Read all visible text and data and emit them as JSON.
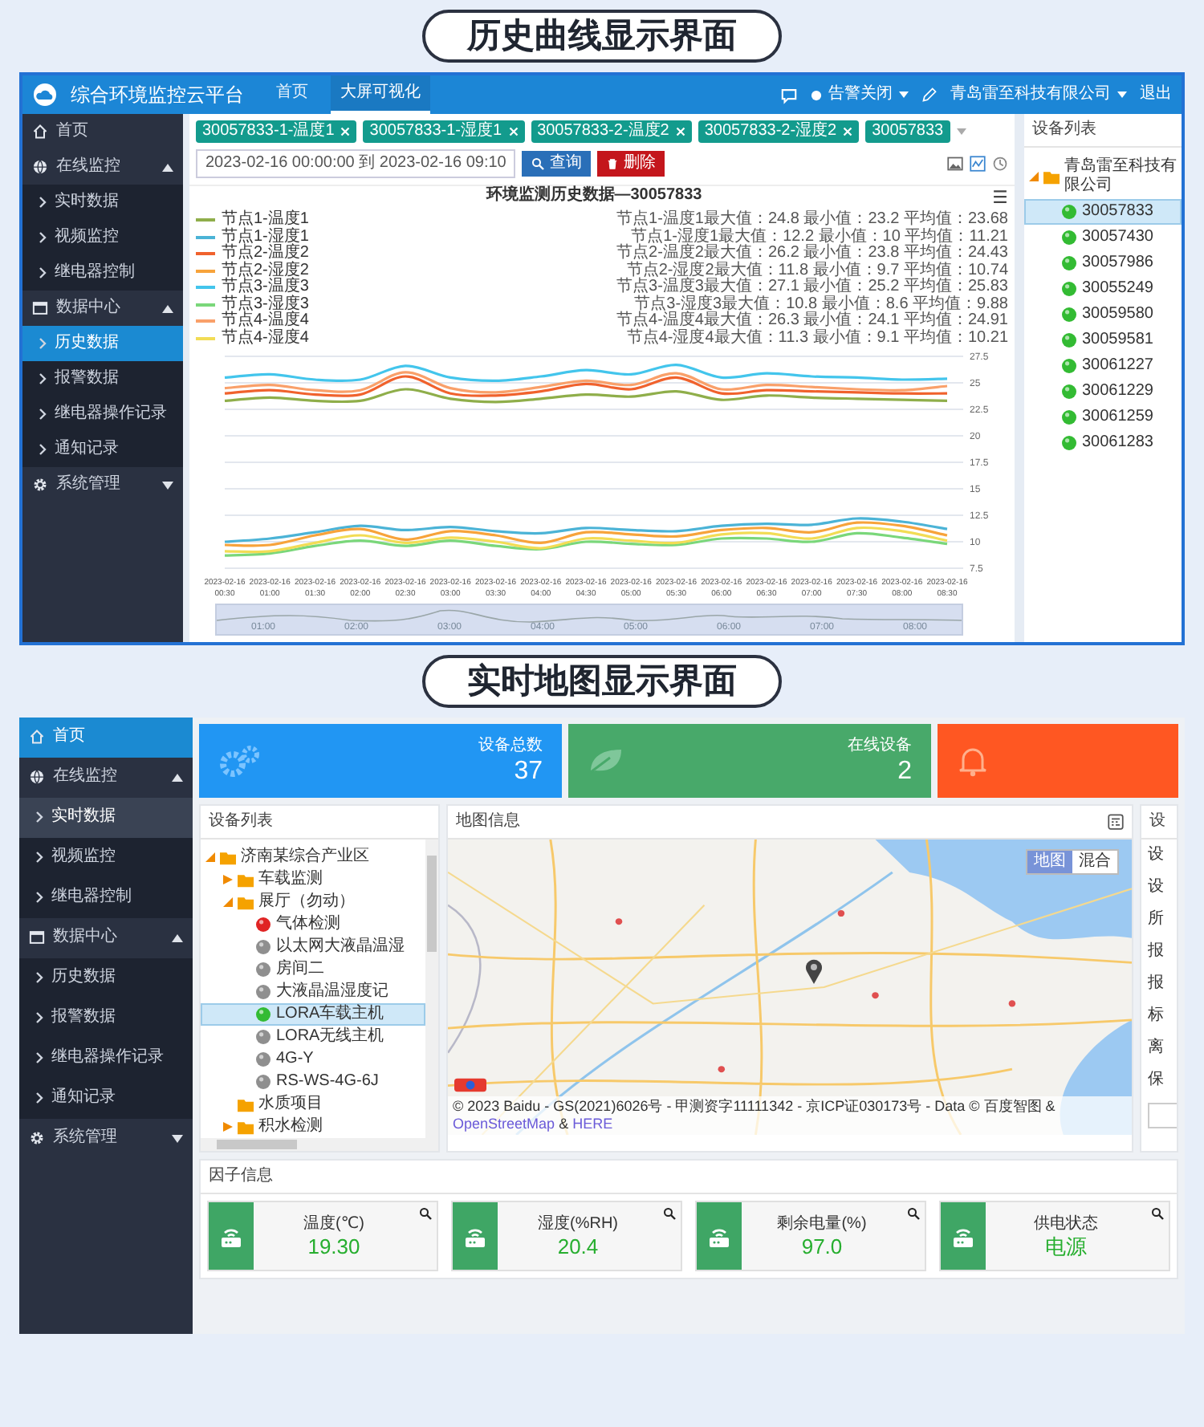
{
  "history_heading": "历史曲线显示界面",
  "history_screen": {
    "app_title": "综合环境监控云平台",
    "nav_tabs": [
      {
        "label": "首页",
        "selected": false
      },
      {
        "label": "大屏可视化",
        "selected": true
      }
    ],
    "alarm_menu": "告警关闭",
    "user_menu": "青岛雷至科技有限公司",
    "logout": "退出",
    "sidebar": [
      {
        "label": "首页",
        "selected": false
      },
      {
        "label": "在线监控",
        "selected": false,
        "expanded": true,
        "children": [
          {
            "label": "实时数据",
            "selected": false
          },
          {
            "label": "视频监控",
            "selected": false
          },
          {
            "label": "继电器控制",
            "selected": false
          }
        ]
      },
      {
        "label": "数据中心",
        "selected": false,
        "expanded": true,
        "children": [
          {
            "label": "历史数据",
            "selected": true
          },
          {
            "label": "报警数据",
            "selected": false
          },
          {
            "label": "继电器操作记录",
            "selected": false
          },
          {
            "label": "通知记录",
            "selected": false
          }
        ]
      },
      {
        "label": "系统管理",
        "selected": false,
        "expanded": false
      }
    ],
    "tags": [
      {
        "label": "30057833-1-温度1",
        "removable": true
      },
      {
        "label": "30057833-1-湿度1",
        "removable": true
      },
      {
        "label": "30057833-2-温度2",
        "removable": true
      },
      {
        "label": "30057833-2-湿度2",
        "removable": true
      },
      {
        "label": "30057833",
        "removable": false
      }
    ],
    "date_range": "2023-02-16 00:00:00 到 2023-02-16 09:10",
    "buttons": [
      {
        "label": "查询",
        "kind": "search"
      },
      {
        "label": "删除",
        "kind": "delete"
      }
    ],
    "chart": {
      "summary_lines": [
        "节点1-温度1最大值：24.8 最小值：23.2 平均值：23.68",
        "节点1-湿度1最大值：12.2 最小值：10 平均值：11.21",
        "节点2-温度2最大值：26.2 最小值：23.8 平均值：24.43",
        "节点2-湿度2最大值：11.8 最小值：9.7 平均值：10.74",
        "节点3-温度3最大值：27.1 最小值：25.2 平均值：25.83",
        "节点3-湿度3最大值：10.8 最小值：8.6 平均值：9.88",
        "节点4-温度4最大值：26.3 最小值：24.1 平均值：24.91",
        "节点4-湿度4最大值：11.3 最小值：9.1 平均值：10.21"
      ],
      "zoom_labels": [
        "01:00",
        "02:00",
        "03:00",
        "04:00",
        "05:00",
        "06:00",
        "07:00",
        "08:00"
      ],
      "chart_data": {
        "type": "line",
        "title": "环境监测历史数据—30057833",
        "categories": [
          "2023-02-16 00:30",
          "2023-02-16 01:00",
          "2023-02-16 01:30",
          "2023-02-16 02:00",
          "2023-02-16 02:30",
          "2023-02-16 03:00",
          "2023-02-16 03:30",
          "2023-02-16 04:00",
          "2023-02-16 04:30",
          "2023-02-16 05:00",
          "2023-02-16 05:30",
          "2023-02-16 06:00",
          "2023-02-16 06:30",
          "2023-02-16 07:00",
          "2023-02-16 07:30",
          "2023-02-16 08:00",
          "2023-02-16 08:30"
        ],
        "ylim": [
          7.5,
          27.5
        ],
        "grid": true,
        "legend": true,
        "yticks": [
          7.5,
          10,
          12.5,
          15,
          17.5,
          20,
          22.5,
          25,
          27.5
        ],
        "series": [
          {
            "name": "节点1-温度1",
            "color": "#8fae4a",
            "values": [
              23.3,
              23.6,
              23.3,
              23.3,
              24.4,
              23.5,
              23.2,
              23.5,
              23.9,
              23.7,
              24.2,
              23.4,
              23.8,
              23.6,
              23.5,
              23.4,
              23.3
            ]
          },
          {
            "name": "节点1-湿度1",
            "color": "#4bb3d6",
            "values": [
              10.0,
              10.3,
              10.9,
              11.5,
              11.1,
              11.4,
              11.0,
              10.8,
              11.3,
              11.1,
              11.0,
              11.5,
              11.7,
              11.6,
              12.2,
              11.9,
              11.2
            ]
          },
          {
            "name": "节点2-温度2",
            "color": "#f0622d",
            "values": [
              24.0,
              24.3,
              23.9,
              23.9,
              25.6,
              24.0,
              23.8,
              24.2,
              24.9,
              24.4,
              25.5,
              24.0,
              24.3,
              24.2,
              24.1,
              24.0,
              24.0
            ]
          },
          {
            "name": "节点2-湿度2",
            "color": "#f7a33b",
            "values": [
              9.7,
              9.7,
              10.6,
              11.2,
              10.2,
              11.0,
              10.6,
              9.9,
              10.9,
              10.7,
              10.5,
              11.1,
              11.3,
              10.9,
              11.8,
              11.5,
              10.6
            ]
          },
          {
            "name": "节点3-温度3",
            "color": "#43c5ec",
            "values": [
              25.5,
              25.8,
              25.3,
              25.3,
              26.6,
              25.5,
              25.2,
              25.6,
              26.2,
              25.8,
              26.7,
              25.5,
              25.9,
              25.6,
              25.5,
              25.3,
              25.4
            ]
          },
          {
            "name": "节点3-湿度3",
            "color": "#7ad77a",
            "values": [
              8.7,
              8.9,
              9.6,
              10.1,
              9.6,
              10.1,
              9.6,
              9.3,
              10.0,
              9.8,
              9.7,
              10.3,
              10.3,
              10.0,
              10.8,
              10.4,
              9.8
            ]
          },
          {
            "name": "节点4-温度4",
            "color": "#f9a06a",
            "values": [
              24.5,
              24.8,
              24.3,
              24.3,
              26.0,
              24.5,
              24.1,
              24.6,
              25.2,
              24.8,
              25.9,
              24.4,
              24.8,
              24.6,
              24.4,
              24.3,
              24.7
            ]
          },
          {
            "name": "节点4-湿度4",
            "color": "#f2dc55",
            "values": [
              9.1,
              9.1,
              9.9,
              10.6,
              9.9,
              10.4,
              10.0,
              9.4,
              10.3,
              10.1,
              9.9,
              10.7,
              10.8,
              10.3,
              11.3,
              11.0,
              10.1
            ]
          }
        ]
      }
    },
    "device_panel": {
      "title": "设备列表",
      "root": {
        "label": "青岛雷至科技有限公司",
        "kind": "folder",
        "expanded": true,
        "children": [
          {
            "label": "30057833",
            "kind": "device",
            "color": "#33bb33",
            "selected": true
          },
          {
            "label": "30057430",
            "kind": "device",
            "color": "#33bb33",
            "selected": false
          },
          {
            "label": "30057986",
            "kind": "device",
            "color": "#33bb33",
            "selected": false
          },
          {
            "label": "30055249",
            "kind": "device",
            "color": "#33bb33",
            "selected": false
          },
          {
            "label": "30059580",
            "kind": "device",
            "color": "#33bb33",
            "selected": false
          },
          {
            "label": "30059581",
            "kind": "device",
            "color": "#33bb33",
            "selected": false
          },
          {
            "label": "30061227",
            "kind": "device",
            "color": "#33bb33",
            "selected": false
          },
          {
            "label": "30061229",
            "kind": "device",
            "color": "#33bb33",
            "selected": false
          },
          {
            "label": "30061259",
            "kind": "device",
            "color": "#33bb33",
            "selected": false
          },
          {
            "label": "30061283",
            "kind": "device",
            "color": "#33bb33",
            "selected": false
          }
        ]
      }
    }
  },
  "map_heading": "实时地图显示界面",
  "map_screen": {
    "sidebar": [
      {
        "label": "首页",
        "selected": true
      },
      {
        "label": "在线监控",
        "selected": false,
        "expanded": true,
        "children": [
          {
            "label": "实时数据",
            "selected": true
          },
          {
            "label": "视频监控",
            "selected": false
          },
          {
            "label": "继电器控制",
            "selected": false
          }
        ]
      },
      {
        "label": "数据中心",
        "selected": false,
        "expanded": true,
        "children": [
          {
            "label": "历史数据",
            "selected": false
          },
          {
            "label": "报警数据",
            "selected": false
          },
          {
            "label": "继电器操作记录",
            "selected": false
          },
          {
            "label": "通知记录",
            "selected": false
          }
        ]
      },
      {
        "label": "系统管理",
        "selected": false,
        "expanded": false
      }
    ],
    "stat_cards": [
      {
        "kind": "devices",
        "label": "设备总数",
        "value": "37",
        "color": "#2196f3"
      },
      {
        "kind": "online",
        "label": "在线设备",
        "value": "2",
        "color": "#48a96a"
      },
      {
        "kind": "alarm",
        "color": "#ff5722"
      }
    ],
    "device_tree": {
      "title": "设备列表",
      "root": {
        "label": "济南某综合产业区",
        "kind": "folder",
        "expanded": true,
        "children": [
          {
            "label": "车载监测",
            "kind": "folder",
            "expanded": false
          },
          {
            "label": "展厅（勿动）",
            "kind": "folder",
            "expanded": true,
            "children": [
              {
                "label": "气体检测",
                "kind": "device",
                "color": "#e02424",
                "selected": false
              },
              {
                "label": "以太网大液晶温湿",
                "kind": "device",
                "color": "#8f8f8f",
                "selected": false
              },
              {
                "label": "房间二",
                "kind": "device",
                "color": "#8f8f8f",
                "selected": false
              },
              {
                "label": "大液晶温湿度记",
                "kind": "device",
                "color": "#8f8f8f",
                "selected": false
              },
              {
                "label": "LORA车载主机",
                "kind": "device",
                "color": "#33bb33",
                "selected": true
              },
              {
                "label": "LORA无线主机",
                "kind": "device",
                "color": "#8f8f8f",
                "selected": false
              },
              {
                "label": "4G-Y",
                "kind": "device",
                "color": "#8f8f8f",
                "selected": false
              },
              {
                "label": "RS-WS-4G-6J",
                "kind": "device",
                "color": "#8f8f8f",
                "selected": false
              }
            ]
          },
          {
            "label": "水质项目",
            "kind": "folder"
          },
          {
            "label": "积水检测",
            "kind": "folder",
            "expanded": false
          }
        ]
      }
    },
    "map_panel": {
      "title": "地图信息",
      "map_types": [
        {
          "label": "地图",
          "selected": true
        },
        {
          "label": "混合",
          "selected": false
        }
      ],
      "attribution": [
        {
          "kind": "text",
          "text": "© 2023 Baidu - GS(2021)6026号 - 甲测资字11111342 - 京ICP证030173号 - Data © 百度智图 &"
        },
        {
          "kind": "link",
          "text": "OpenStreetMap"
        },
        {
          "kind": "text",
          "text": "&"
        },
        {
          "kind": "link",
          "text": "HERE"
        }
      ]
    },
    "side_panel": {
      "title": "设",
      "rows": [
        "设",
        "设",
        "所",
        "报",
        "报",
        "标",
        "离",
        "保"
      ]
    },
    "factors": {
      "title": "因子信息",
      "items": [
        {
          "label": "温度(℃)",
          "value": "19.30"
        },
        {
          "label": "湿度(%RH)",
          "value": "20.4"
        },
        {
          "label": "剩余电量(%)",
          "value": "97.0"
        },
        {
          "label": "供电状态",
          "value": "电源"
        }
      ]
    }
  }
}
